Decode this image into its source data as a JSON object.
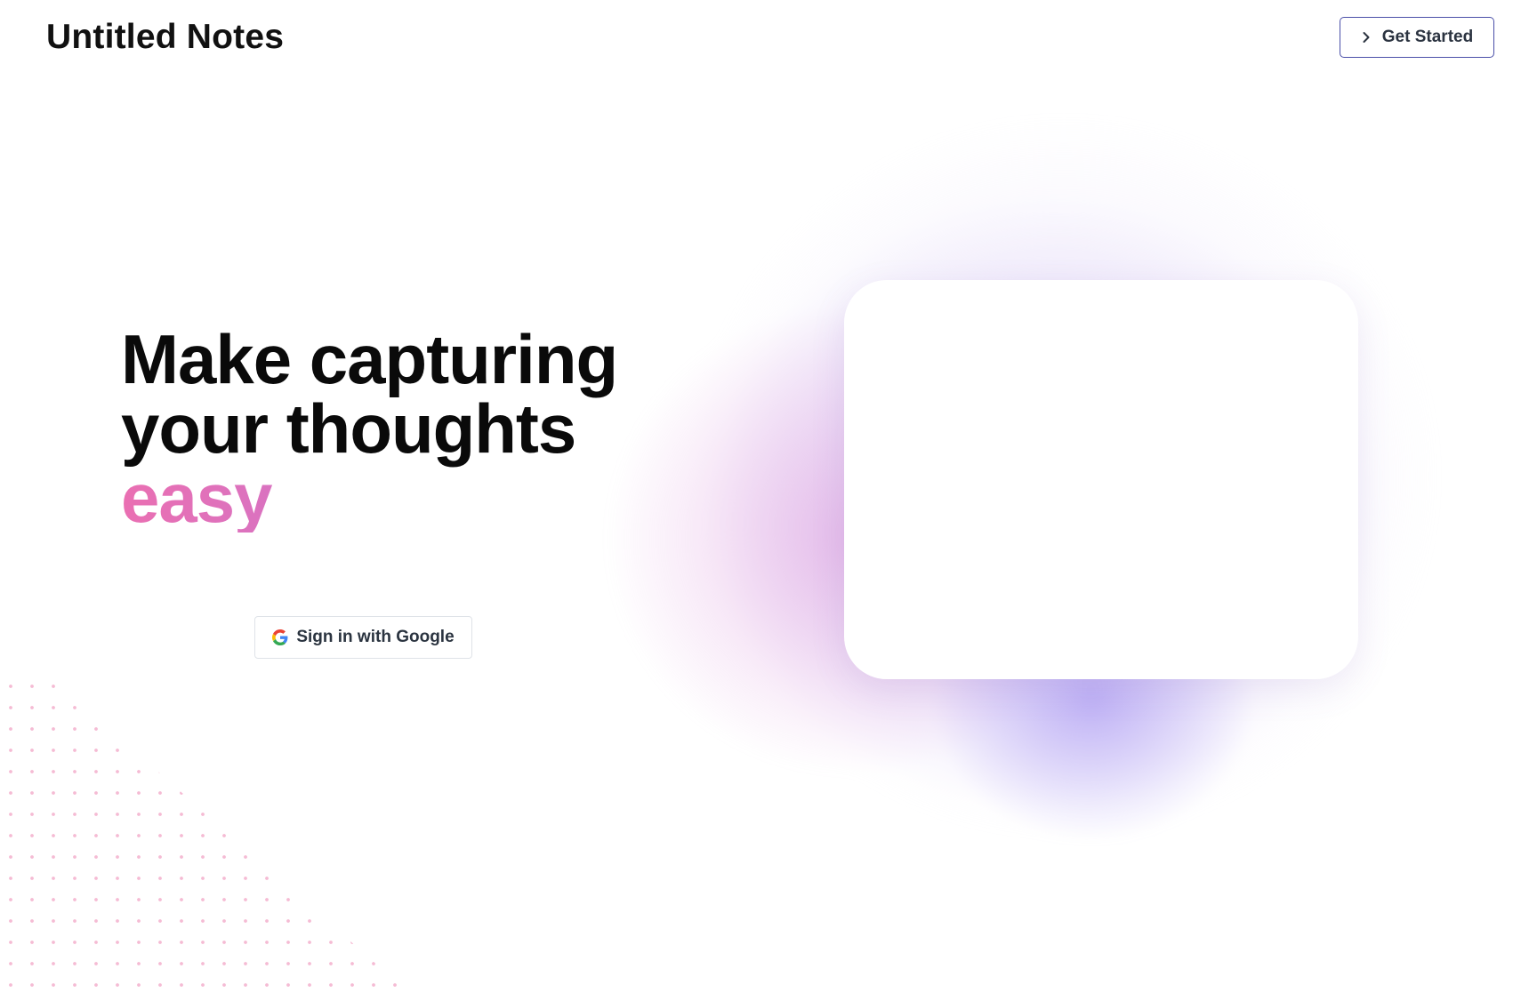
{
  "header": {
    "brand": "Untitled Notes",
    "cta_label": "Get Started",
    "cta_icon": "chevron-right-icon"
  },
  "hero": {
    "title_line1": "Make capturing",
    "title_line2": "your thoughts",
    "title_accent": "easy",
    "google_button_label": "Sign in with Google",
    "google_icon": "google-icon"
  },
  "colors": {
    "accent_start": "#ea6fb2",
    "accent_end": "#b57be0",
    "button_border": "#4a4fa8",
    "text_dark": "#0a0a0a"
  }
}
